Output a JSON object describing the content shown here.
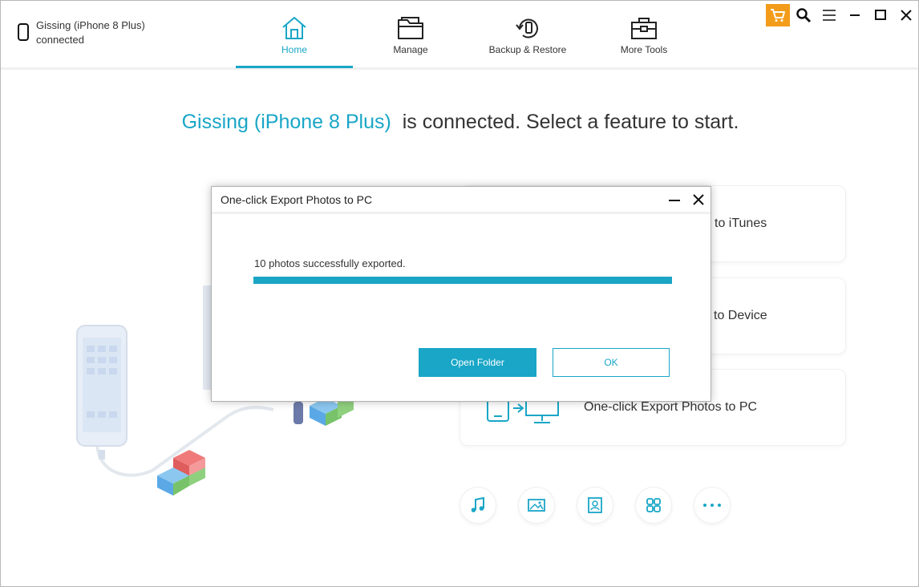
{
  "header": {
    "device_name": "Gissing (iPhone 8 Plus)",
    "device_status": "connected",
    "tabs": [
      {
        "label": "Home",
        "icon": "home-icon",
        "active": true
      },
      {
        "label": "Manage",
        "icon": "folder-icon",
        "active": false
      },
      {
        "label": "Backup & Restore",
        "icon": "backup-restore-icon",
        "active": false
      },
      {
        "label": "More Tools",
        "icon": "toolbox-icon",
        "active": false
      }
    ],
    "window_controls": [
      "cart-icon",
      "search-icon",
      "menu-icon",
      "minimize-icon",
      "maximize-icon",
      "close-icon"
    ]
  },
  "main": {
    "heading_device": "Gissing (iPhone 8 Plus)",
    "heading_rest": "is connected. Select a feature to start.",
    "cards": [
      {
        "label": "to iTunes"
      },
      {
        "label": "to Device"
      },
      {
        "label": "One-click Export Photos to PC",
        "icon": "export-to-pc-icon"
      }
    ],
    "quick_icons": [
      "music-icon",
      "photo-icon",
      "contacts-icon",
      "apps-icon",
      "more-icon"
    ]
  },
  "dialog": {
    "title": "One-click Export Photos to PC",
    "message": "10 photos successfully exported.",
    "progress": 1.0,
    "open_folder_label": "Open Folder",
    "ok_label": "OK"
  },
  "colors": {
    "accent": "#19a6c7",
    "cart": "#f39c1a"
  }
}
